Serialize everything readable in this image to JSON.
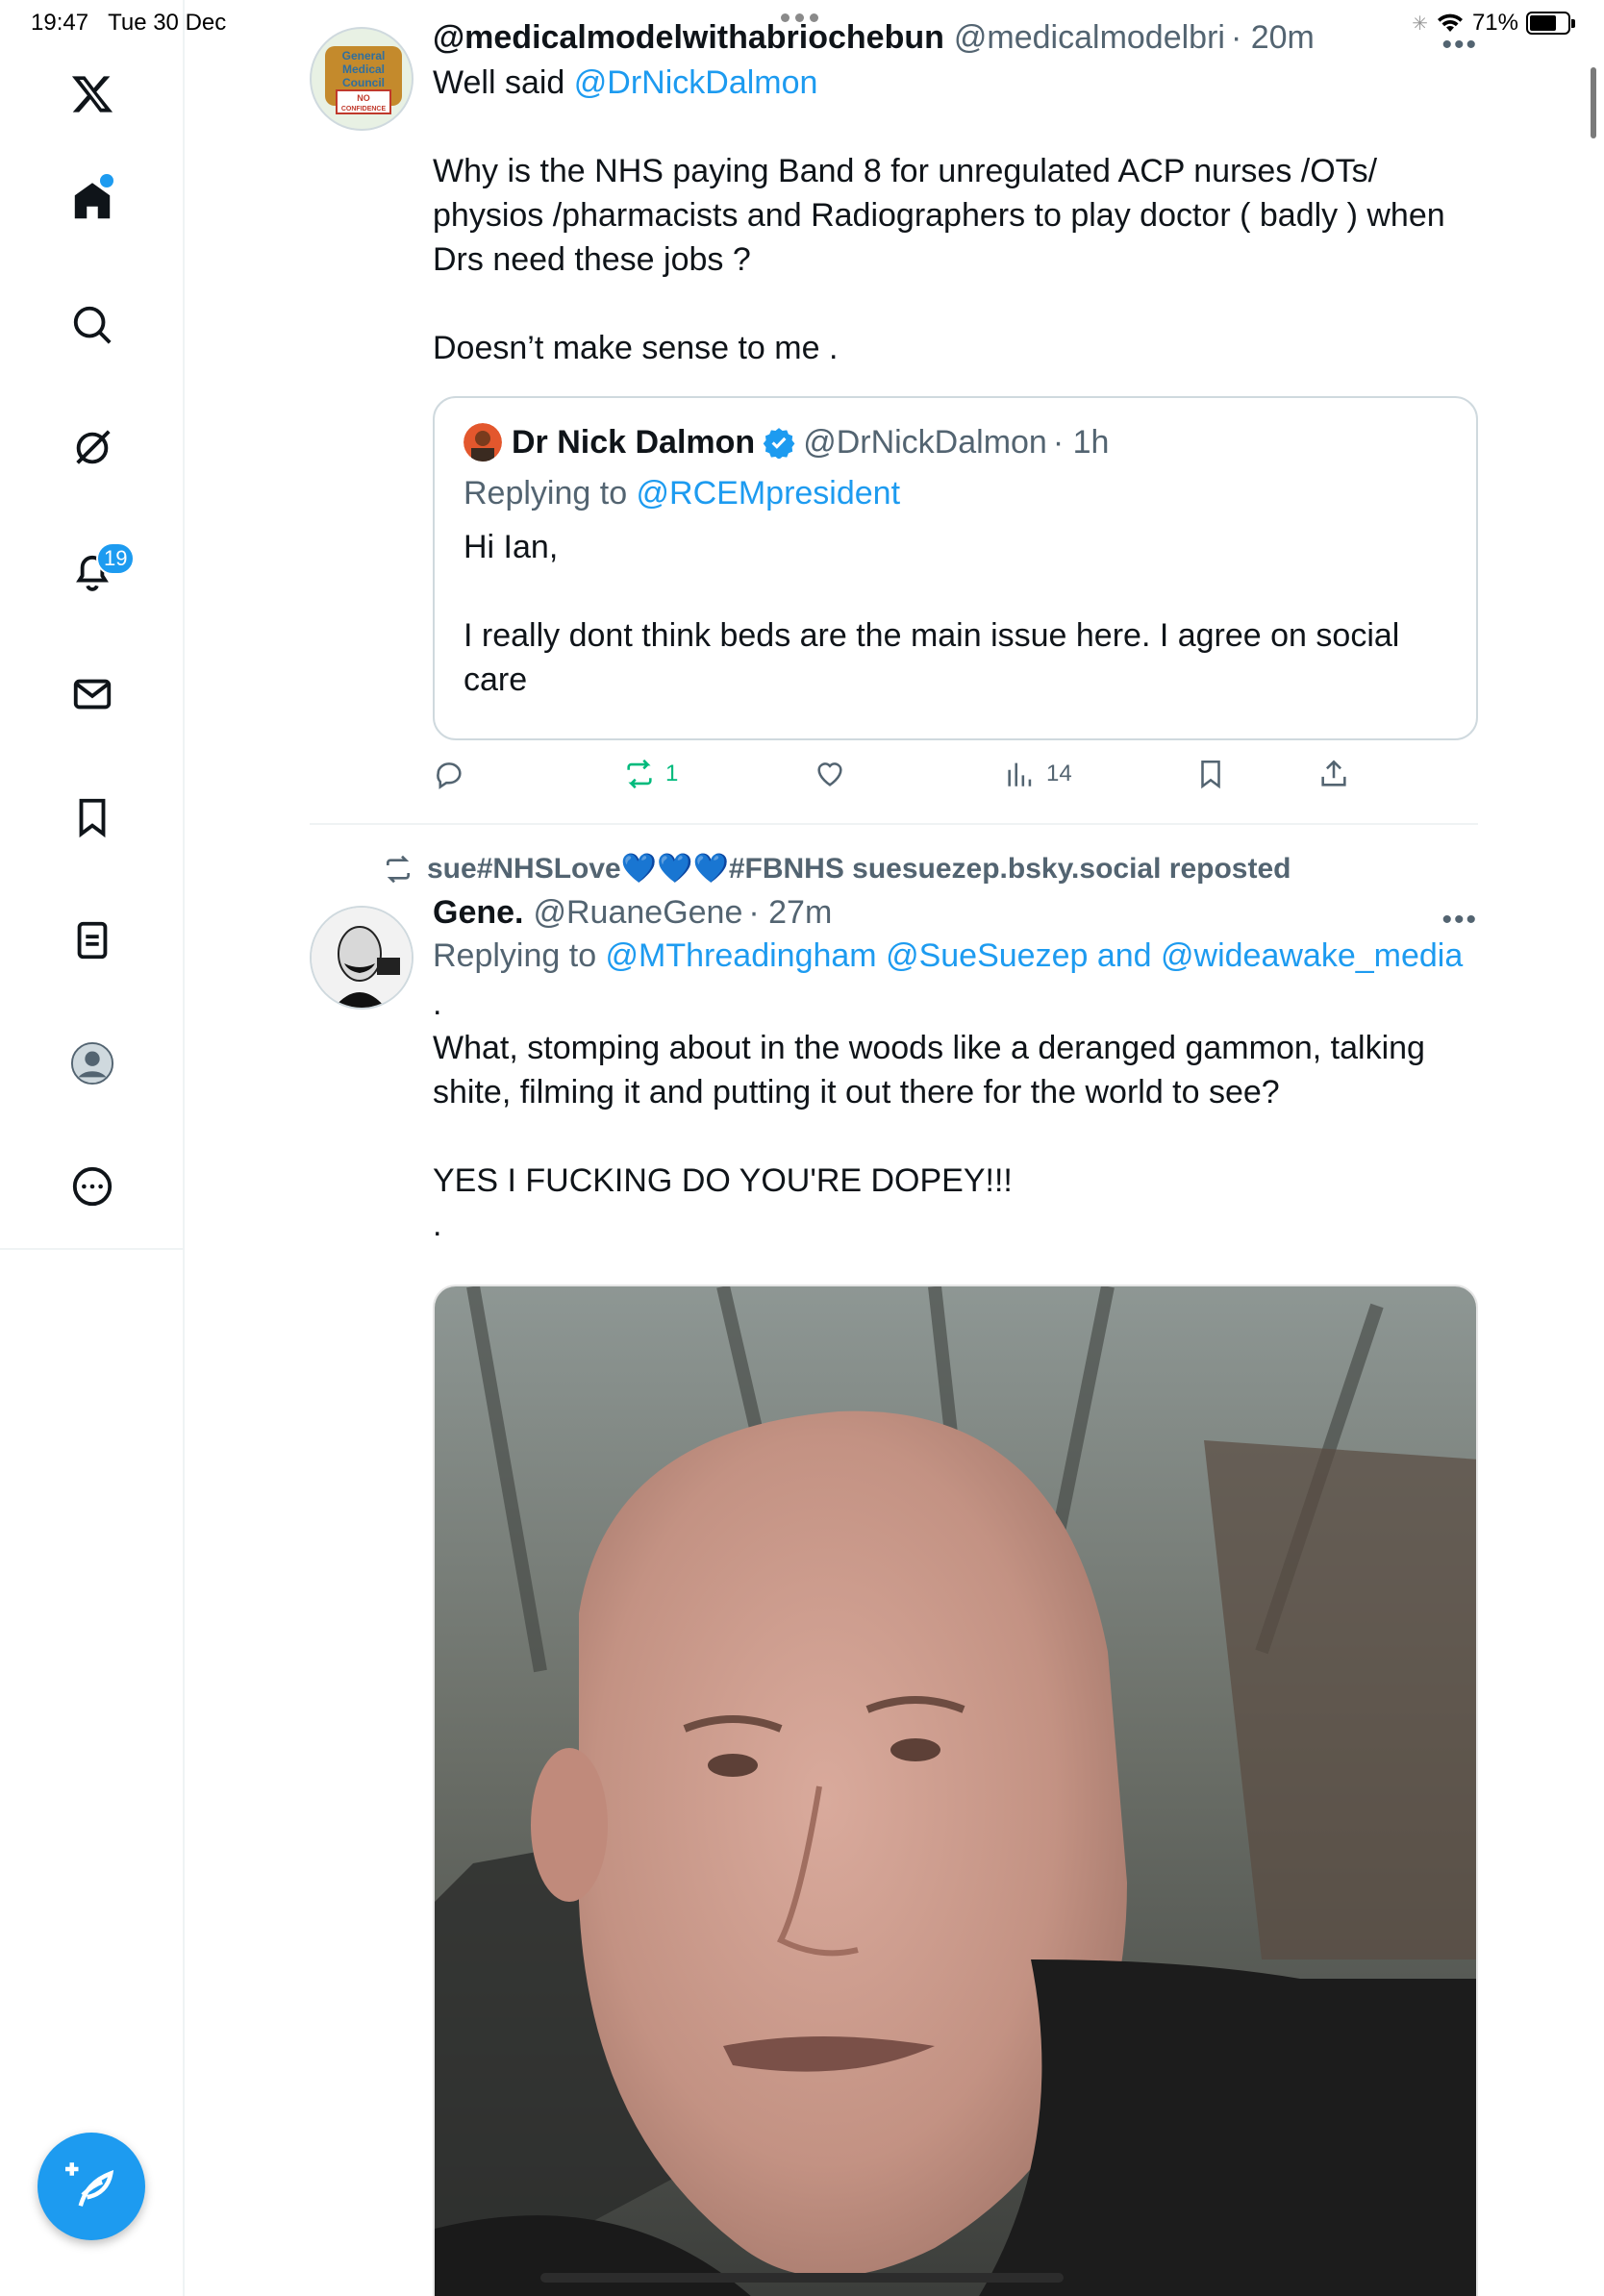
{
  "status_bar": {
    "time": "19:47",
    "date": "Tue 30 Dec",
    "battery": "71%",
    "battery_level": 0.71
  },
  "sidebar": {
    "items": [
      {
        "name": "x-logo"
      },
      {
        "name": "home"
      },
      {
        "name": "search"
      },
      {
        "name": "grok"
      },
      {
        "name": "notifications",
        "badge": "19"
      },
      {
        "name": "messages"
      },
      {
        "name": "bookmarks"
      },
      {
        "name": "lists"
      },
      {
        "name": "profile"
      },
      {
        "name": "more"
      }
    ]
  },
  "tweets": [
    {
      "display_name": "@medicalmodelwithabriochebun",
      "handle": "@medicalmodelbri",
      "time": "· 20m",
      "lines": {
        "l1_text": "Well said ",
        "l1_mention": "@DrNickDalmon",
        "p2": "Why is the NHS paying Band 8 for unregulated ACP nurses /OTs/ physios /pharmacists and Radiographers to play doctor ( badly ) when Drs need these jobs ?",
        "p3": "Doesn’t make sense to me ."
      },
      "avatar_text": [
        "General",
        "Medical",
        "Council",
        "NO",
        "CONFIDENCE"
      ],
      "quote": {
        "display_name": "Dr Nick Dalmon",
        "handle": "@DrNickDalmon",
        "time": "· 1h",
        "replying_label": "Replying to ",
        "replying_to": "@RCEMpresident",
        "p1": "Hi Ian,",
        "p2": "I really dont think beds are the main issue here. I agree on social care"
      },
      "actions": {
        "replies": "",
        "reposts": "1",
        "likes": "",
        "views": "14"
      }
    },
    {
      "repost_banner": {
        "prefix": "sue#NHSLove",
        "hearts": "💙💙💙",
        "suffix": "#FBNHS suesuezep.bsky.social reposted"
      },
      "display_name": "Gene.",
      "handle": "@RuaneGene",
      "time": "· 27m",
      "replying_label": "Replying to ",
      "replying_to": "@MThreadingham @SueSuezep and @wideawake_media",
      "lines": {
        "dot1": ".",
        "p1": "What, stomping about in the woods like a deranged gammon, talking shite, filming it and putting it out there for the world to see?",
        "p2": "YES I FUCKING DO YOU'RE DOPEY!!!",
        "dot2": "."
      }
    }
  ],
  "colors": {
    "accent": "#1d9bf0",
    "repost_green": "#00ba7c",
    "muted": "#536471"
  }
}
